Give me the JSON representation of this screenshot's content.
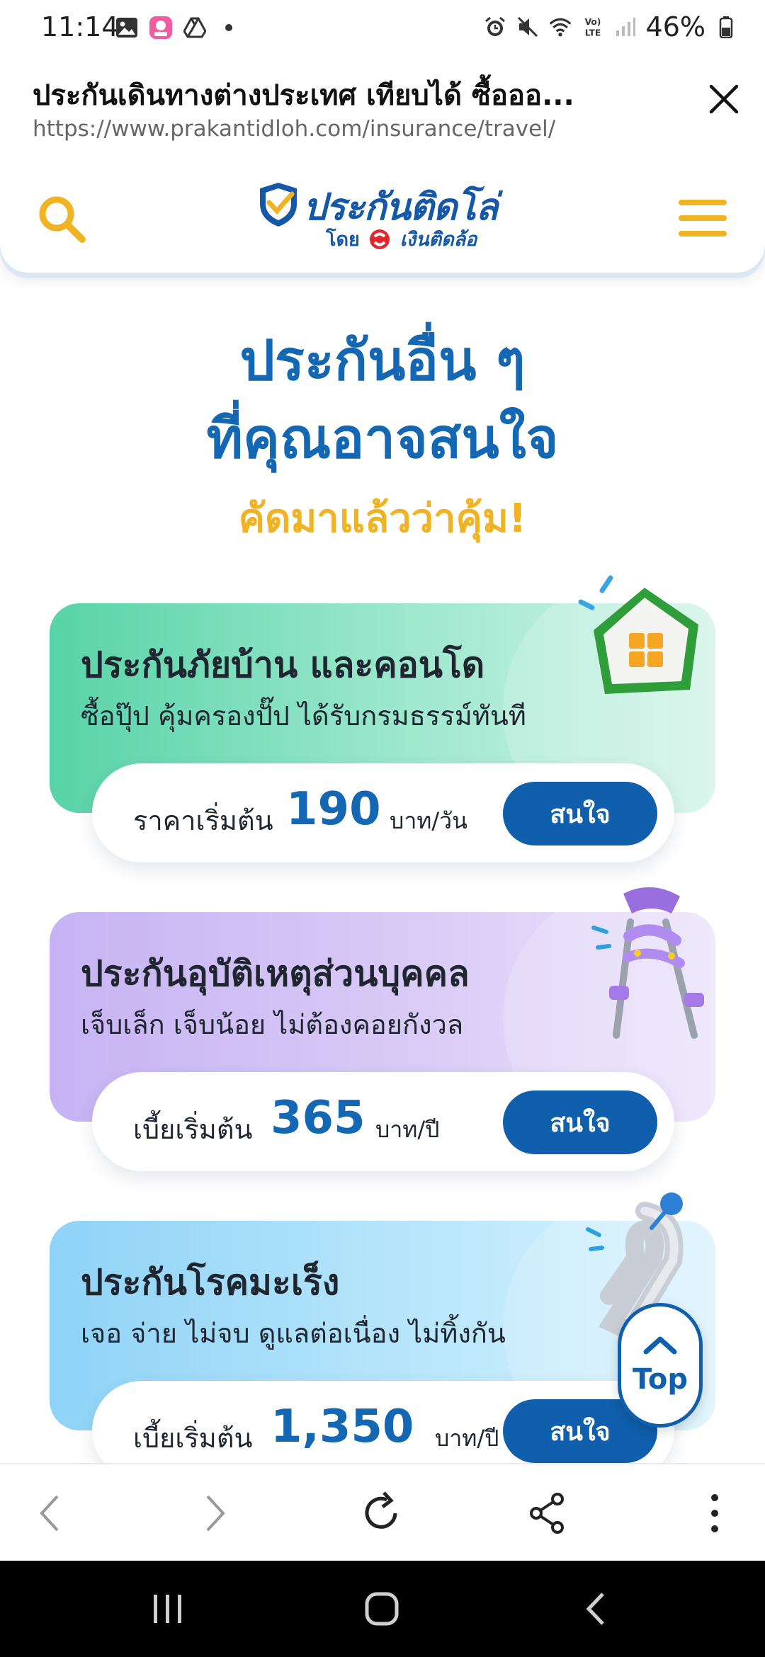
{
  "status_bar": {
    "time": "11:14",
    "battery_percent": "46%",
    "icons_left": [
      "gallery-icon",
      "lazada-app-icon",
      "drive-icon",
      "notification-dot-icon"
    ],
    "icons_right": [
      "alarm-icon",
      "mute-icon",
      "wifi-icon",
      "volte-icon",
      "signal-icon",
      "battery-icon"
    ]
  },
  "tab": {
    "title": "ประกันเดินทางต่างประเทศ เทียบได้ ซื้อออ...",
    "url": "https://www.prakantidloh.com/insurance/travel/"
  },
  "site_header": {
    "logo_main": "ประกันติดโล่",
    "logo_by": "โดย",
    "logo_brand": "เงินติดล้อ"
  },
  "section": {
    "title_line1": "ประกันอื่น ๆ",
    "title_line2": "ที่คุณอาจสนใจ",
    "subtitle": "คัดมาแล้วว่าคุ้ม!"
  },
  "cards": [
    {
      "title": "ประกันภัยบ้าน และคอนโด",
      "subtitle": "ซื้อปุ๊ป คุ้มครองปั๊ป ได้รับกรมธรรม์ทันที",
      "price_label": "ราคาเริ่มต้น",
      "price": "190",
      "unit": "บาท/วัน",
      "button": "สนใจ",
      "icon": "house-icon"
    },
    {
      "title": "ประกันอุบัติเหตุส่วนบุคคล",
      "subtitle": "เจ็บเล็ก เจ็บน้อย ไม่ต้องคอยกังวล",
      "price_label": "เบี้ยเริ่มต้น",
      "price": "365",
      "unit": "บาท/ปี",
      "button": "สนใจ",
      "icon": "crutches-icon"
    },
    {
      "title": "ประกันโรคมะเร็ง",
      "subtitle": "เจอ จ่าย ไม่จบ ดูแลต่อเนื่อง ไม่ทิ้งกัน",
      "price_label": "เบี้ยเริ่มต้น",
      "price": "1,350",
      "unit": "บาท/ปี",
      "button": "สนใจ",
      "icon": "ribbon-icon"
    }
  ],
  "top_button": {
    "label": "Top"
  },
  "colors": {
    "brand_blue": "#1467b3",
    "button_blue": "#0f5fad",
    "accent_yellow": "#f0b323"
  }
}
